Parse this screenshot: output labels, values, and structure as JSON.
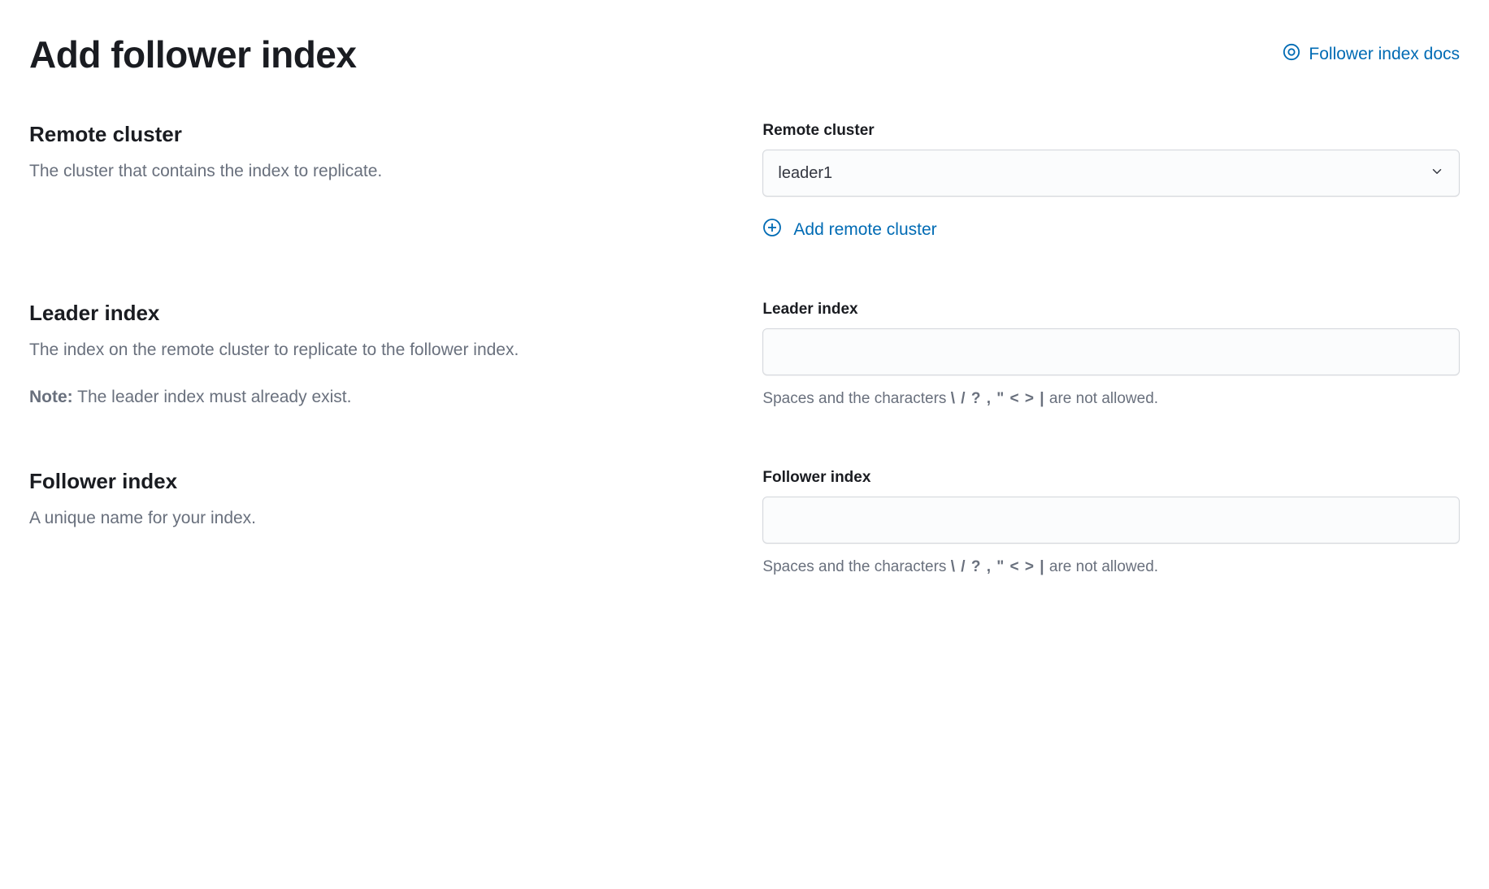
{
  "header": {
    "title": "Add follower index",
    "docs_link": "Follower index docs"
  },
  "sections": {
    "remote_cluster": {
      "title": "Remote cluster",
      "description": "The cluster that contains the index to replicate.",
      "field_label": "Remote cluster",
      "selected_value": "leader1",
      "add_link": "Add remote cluster"
    },
    "leader_index": {
      "title": "Leader index",
      "description": "The index on the remote cluster to replicate to the follower index.",
      "note_label": "Note:",
      "note_text": " The leader index must already exist.",
      "field_label": "Leader index",
      "value": "",
      "help_prefix": "Spaces and the characters ",
      "help_chars": "\\ / ? , \" < > |",
      "help_suffix": " are not allowed."
    },
    "follower_index": {
      "title": "Follower index",
      "description": "A unique name for your index.",
      "field_label": "Follower index",
      "value": "",
      "help_prefix": "Spaces and the characters ",
      "help_chars": "\\ / ? , \" < > |",
      "help_suffix": " are not allowed."
    }
  }
}
